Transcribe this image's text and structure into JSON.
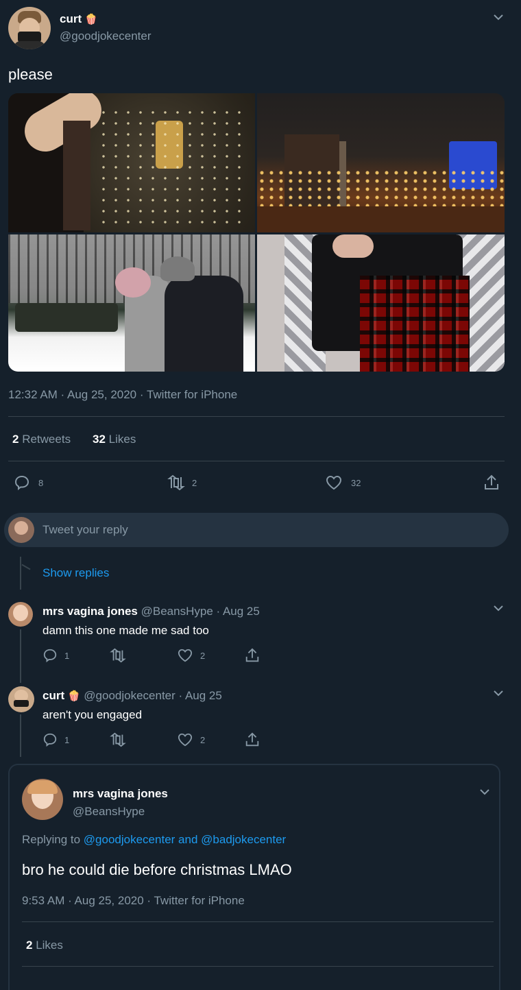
{
  "main_tweet": {
    "display_name": "curt",
    "emoji": "🍿",
    "handle": "@goodjokecenter",
    "text": "please",
    "meta": "12:32 AM · Aug 25, 2020 · Twitter for iPhone",
    "retweets_count": "2",
    "retweets_label": "Retweets",
    "likes_count": "32",
    "likes_label": "Likes",
    "actions": {
      "reply": "8",
      "retweet": "2",
      "like": "32"
    }
  },
  "reply_box": {
    "placeholder": "Tweet your reply"
  },
  "show_replies": "Show replies",
  "replies": [
    {
      "display_name": "mrs vagina jones",
      "handle_time": "@BeansHype · Aug 25",
      "text": "damn this one made me sad too",
      "reply_count": "1",
      "like_count": "2"
    },
    {
      "display_name": "curt",
      "emoji": "🍿",
      "handle_time": "@goodjokecenter · Aug 25",
      "text": "aren't you engaged",
      "reply_count": "1",
      "like_count": "2"
    }
  ],
  "focused_tweet": {
    "display_name": "mrs vagina jones",
    "handle": "@BeansHype",
    "replying_prefix": "Replying to",
    "replying_to_1": "@goodjokecenter",
    "replying_and": "and",
    "replying_to_2": "@badjokecenter",
    "text": "bro he could die before christmas LMAO",
    "meta": "9:53 AM · Aug 25, 2020 · Twitter for iPhone",
    "likes_count": "2",
    "likes_label": "Likes"
  },
  "colors": {
    "background": "#15202b",
    "muted": "#8899a6",
    "link": "#1d9bf0",
    "divider": "#38444d"
  }
}
